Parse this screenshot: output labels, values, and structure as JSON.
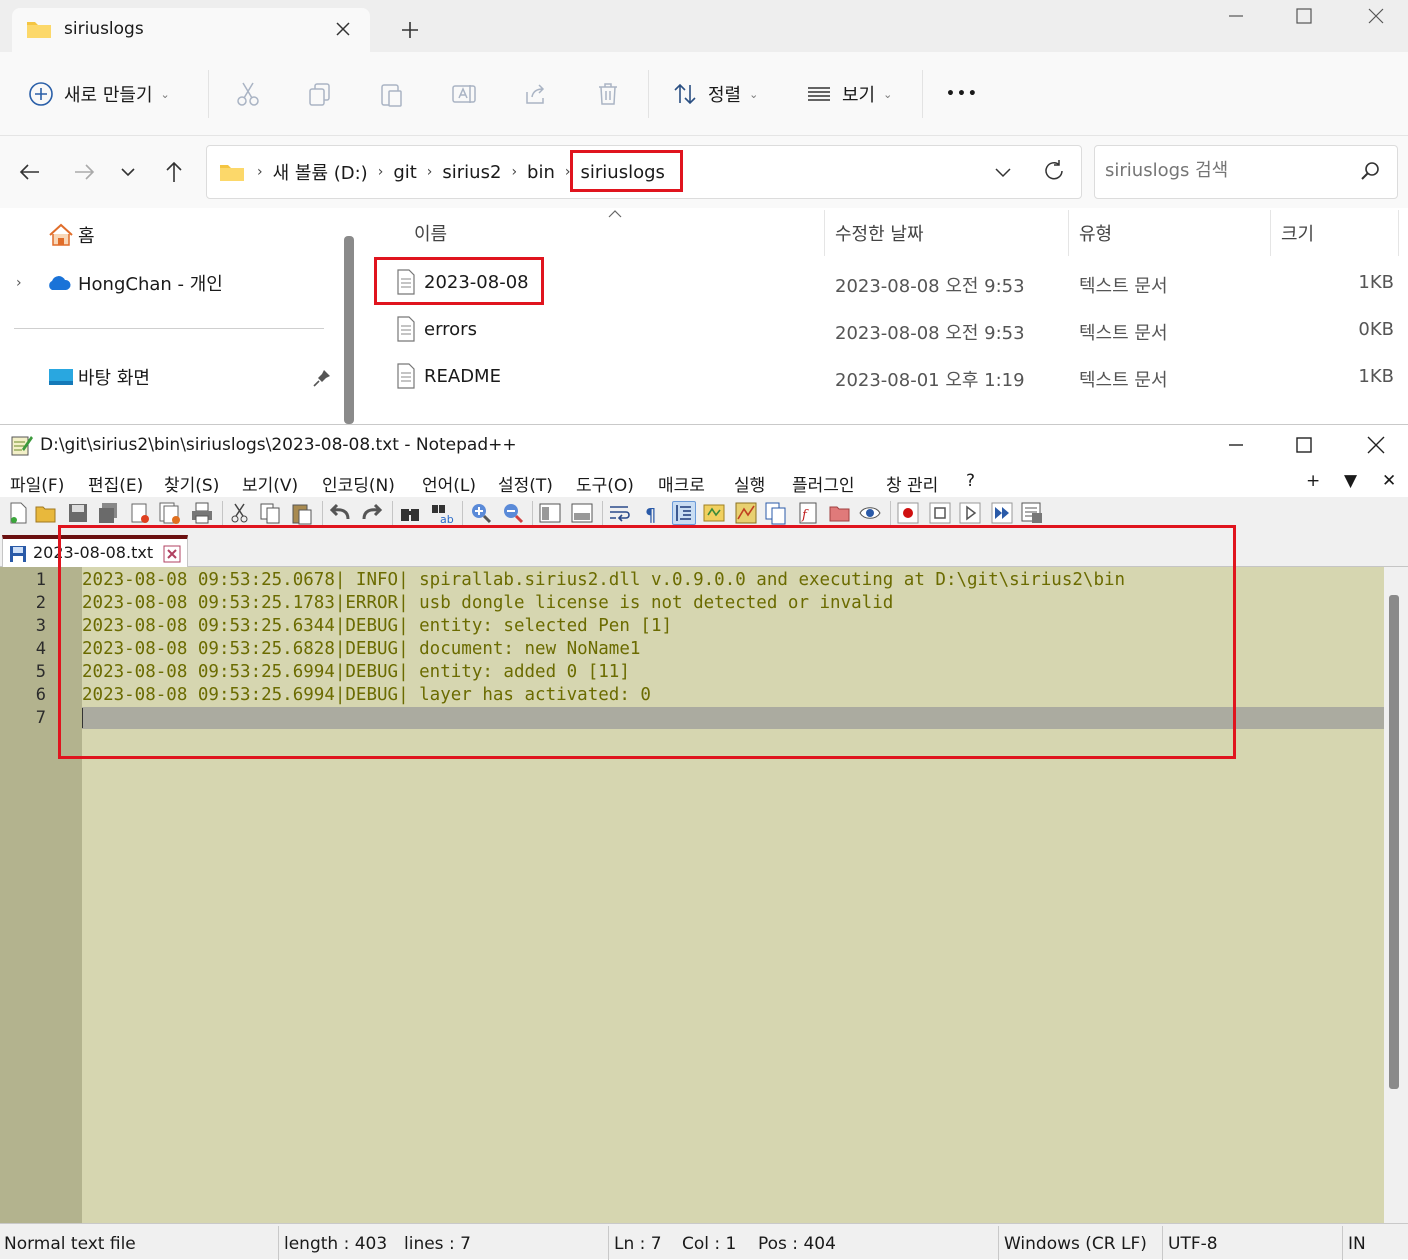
{
  "explorer": {
    "tab_title": "siriuslogs",
    "new_tab_symbol": "+",
    "toolbar": {
      "new_label": "새로 만들기",
      "sort_label": "정렬",
      "view_label": "보기",
      "more_symbol": "•••"
    },
    "breadcrumbs": [
      "새 볼륨 (D:)",
      "git",
      "sirius2",
      "bin",
      "siriuslogs"
    ],
    "search_placeholder": "siriuslogs 검색",
    "nav": {
      "home": "홈",
      "onedrive": "HongChan - 개인",
      "desktop": "바탕 화면"
    },
    "columns": {
      "name": "이름",
      "modified": "수정한 날짜",
      "type": "유형",
      "size": "크기"
    },
    "files": [
      {
        "name": "2023-08-08",
        "modified": "2023-08-08 오전 9:53",
        "type": "텍스트 문서",
        "size": "1KB"
      },
      {
        "name": "errors",
        "modified": "2023-08-08 오전 9:53",
        "type": "텍스트 문서",
        "size": "0KB"
      },
      {
        "name": "README",
        "modified": "2023-08-01 오후 1:19",
        "type": "텍스트 문서",
        "size": "1KB"
      }
    ]
  },
  "notepad": {
    "title": "D:\\git\\sirius2\\bin\\siriuslogs\\2023-08-08.txt - Notepad++",
    "menu": [
      "파일(F)",
      "편집(E)",
      "찾기(S)",
      "보기(V)",
      "인코딩(N)",
      "언어(L)",
      "설정(T)",
      "도구(O)",
      "매크로",
      "실행",
      "플러그인",
      "창 관리",
      "?"
    ],
    "menu_right": [
      "+",
      "▼",
      "✕"
    ],
    "tab_name": "2023-08-08.txt",
    "lines": [
      "2023-08-08 09:53:25.0678| INFO| spirallab.sirius2.dll v.0.9.0.0 and executing at D:\\git\\sirius2\\bin",
      "2023-08-08 09:53:25.1783|ERROR| usb dongle license is not detected or invalid",
      "2023-08-08 09:53:25.6344|DEBUG| entity: selected Pen [1]",
      "2023-08-08 09:53:25.6828|DEBUG| document: new NoName1",
      "2023-08-08 09:53:25.6994|DEBUG| entity: added 0 [11]",
      "2023-08-08 09:53:25.6994|DEBUG| layer has activated: 0",
      ""
    ],
    "line_numbers": [
      "1",
      "2",
      "3",
      "4",
      "5",
      "6",
      "7"
    ],
    "status": {
      "file_type": "Normal text file",
      "length": "length : 403",
      "lines": "lines : 7",
      "ln": "Ln : 7",
      "col": "Col : 1",
      "pos": "Pos : 404",
      "eol": "Windows (CR LF)",
      "encoding": "UTF-8",
      "mode": "IN"
    }
  },
  "colors": {
    "highlight": "#e0141e",
    "editor_bg": "#d6d6b0",
    "gutter_bg": "#b3b38e",
    "text": "#6b6b00"
  }
}
